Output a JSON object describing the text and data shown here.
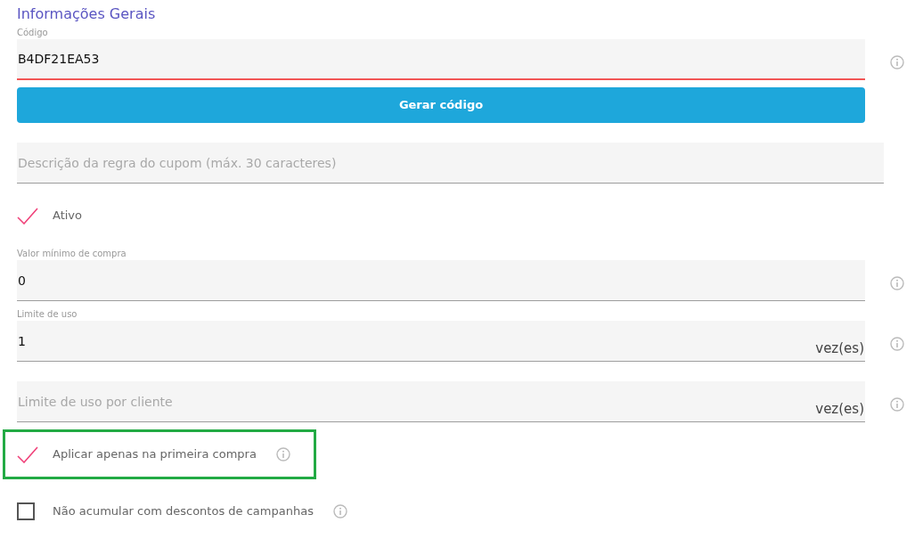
{
  "section_title": "Informações Gerais",
  "items": [
    {
      "kind": "field",
      "label": "Código",
      "value": "B4DF21EA53",
      "error": true,
      "info": true
    },
    {
      "kind": "button",
      "label": "Gerar código"
    },
    {
      "kind": "field",
      "placeholder": "Descrição da regra do cupom (máx. 30 caracteres)",
      "info": false
    },
    {
      "kind": "checkbox",
      "label": "Ativo",
      "checked": true,
      "info": false
    },
    {
      "kind": "field",
      "label": "Valor mínimo de compra",
      "value": "0",
      "info": true
    },
    {
      "kind": "field",
      "label": "Limite de uso",
      "value": "1",
      "suffix": "vez(es)",
      "info": true
    },
    {
      "kind": "field",
      "placeholder": "Limite de uso por cliente",
      "suffix": "vez(es)",
      "info": true
    },
    {
      "kind": "checkbox",
      "label": "Aplicar apenas na primeira compra",
      "checked": true,
      "info": true,
      "highlighted": true
    },
    {
      "kind": "checkbox",
      "label": "Não acumular com descontos de campanhas",
      "checked": false,
      "info": true
    }
  ]
}
